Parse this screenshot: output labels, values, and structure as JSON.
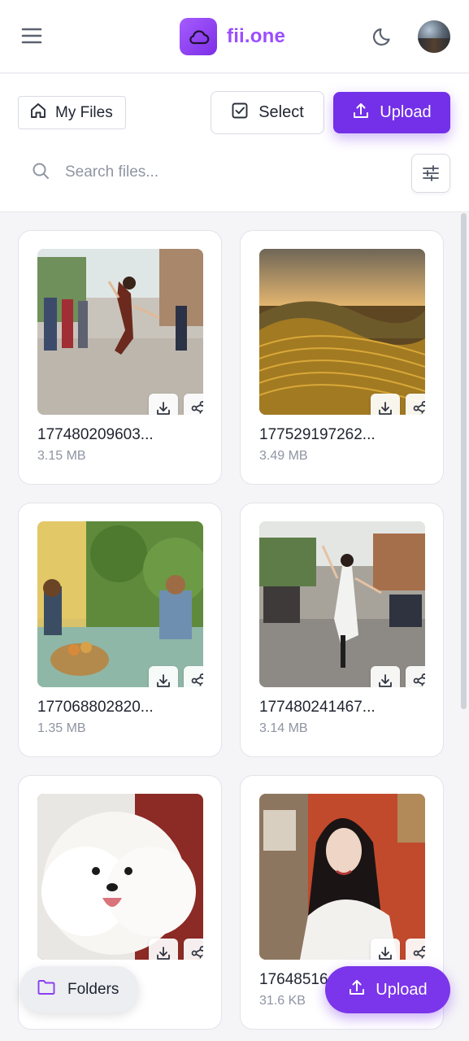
{
  "header": {
    "app_name": "fii.one",
    "icons": {
      "menu": "hamburger-menu-icon",
      "logo": "cloud-icon",
      "theme": "moon-icon",
      "avatar": "user-avatar"
    },
    "brand_color": "#9b4dff"
  },
  "toolbar": {
    "breadcrumb_label": "My Files",
    "select_label": "Select",
    "upload_label": "Upload",
    "search_placeholder": "Search files...",
    "search_value": "",
    "accent_color": "#7430e8"
  },
  "files": [
    {
      "name": "177480209603...",
      "size": "3.15 MB",
      "thumb": "woman-jumping-street"
    },
    {
      "name": "177529197262...",
      "size": "3.49 MB",
      "thumb": "rice-terraces-sunset"
    },
    {
      "name": "177068802820...",
      "size": "1.35 MB",
      "thumb": "people-breakfast-garden"
    },
    {
      "name": "177480241467...",
      "size": "3.14 MB",
      "thumb": "woman-ao-dai-street"
    },
    {
      "name": "",
      "size": "",
      "thumb": "white-pomeranian-dog"
    },
    {
      "name": "17648516",
      "size": "31.6 KB",
      "thumb": "woman-portrait-white-dress"
    }
  ],
  "floating": {
    "folders_label": "Folders",
    "upload_label": "Upload"
  }
}
